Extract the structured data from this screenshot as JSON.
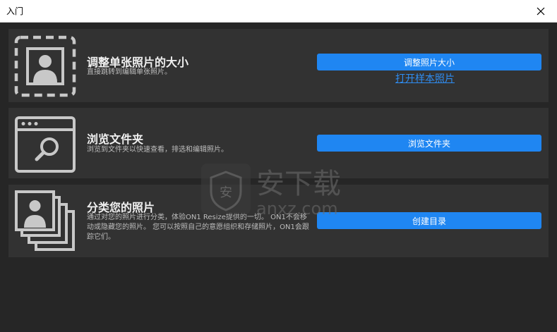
{
  "window": {
    "title": "入门"
  },
  "cards": [
    {
      "title": "调整单张照片的大小",
      "description": "直接跳转到编辑单张照片。",
      "button": "调整照片大小",
      "link": "打开样本照片",
      "icon": "single-photo-icon"
    },
    {
      "title": "浏览文件夹",
      "description": "浏览到文件夹以快速查看，排选和编辑照片。",
      "button": "浏览文件夹",
      "icon": "browser-search-icon"
    },
    {
      "title": "分类您的照片",
      "description": "通过对您的照片进行分类，体验ON1 Resize提供的一切。 ON1不会移动或隐藏您的照片。 您可以按照自己的意愿组织和存储照片，ON1会跟踪它们。",
      "button": "创建目录",
      "icon": "photo-stack-icon"
    }
  ],
  "watermark": {
    "text": "安下载",
    "subtext": "anxz.com"
  }
}
